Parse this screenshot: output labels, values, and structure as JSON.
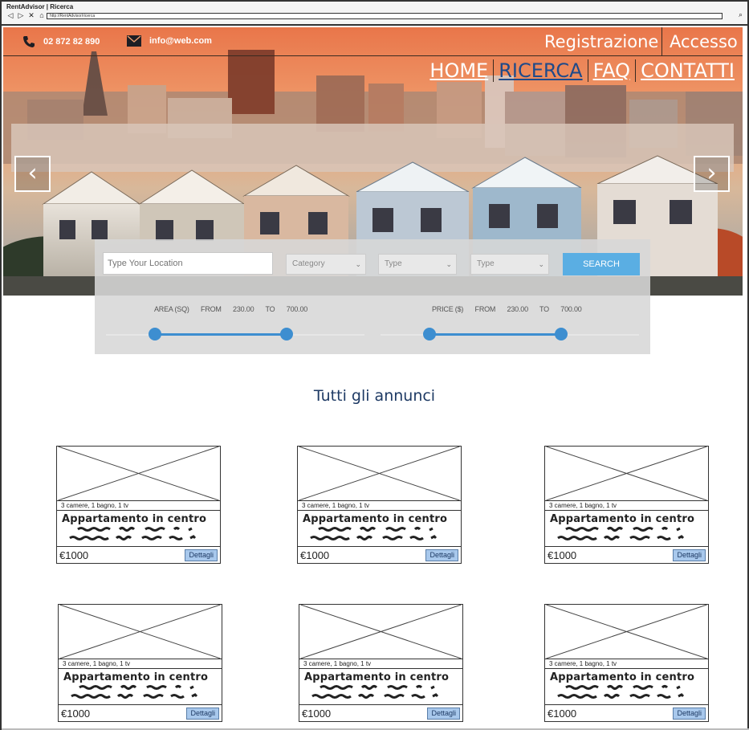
{
  "browser": {
    "title": "RentAdvisor | Ricerca",
    "url": "http://RentAdvisor/ricerca",
    "nav_icons": [
      "back-icon",
      "forward-icon",
      "close-icon",
      "home-icon"
    ]
  },
  "topbar": {
    "phone": "02 872 82 890",
    "email": "info@web.com",
    "register": "Registrazione",
    "login": "Accesso"
  },
  "nav": {
    "items": [
      "HOME",
      "RICERCA",
      "FAQ",
      "CONTATTI"
    ],
    "active": "RICERCA"
  },
  "search": {
    "location_placeholder": "Type Your Location",
    "category": "Category",
    "type1": "Type",
    "type2": "Type",
    "button": "SEARCH",
    "area": {
      "label": "AREA (SQ)",
      "from_label": "FROM",
      "from": "230.00",
      "to_label": "TO",
      "to": "700.00",
      "min_fraction": 0.19,
      "max_fraction": 0.7
    },
    "price": {
      "label": "PRICE ($)",
      "from_label": "FROM",
      "from": "230.00",
      "to_label": "TO",
      "to": "700.00",
      "min_fraction": 0.19,
      "max_fraction": 0.7
    }
  },
  "listings": {
    "title": "Tutti gli annunci",
    "cards": [
      {
        "features": "3 camere, 1 bagno, 1 tv",
        "title": "Appartamento in centro",
        "price": "€1000",
        "details": "Dettagli"
      },
      {
        "features": "3 camere, 1 bagno, 1 tv",
        "title": "Appartamento in centro",
        "price": "€1000",
        "details": "Dettagli"
      },
      {
        "features": "3 camere, 1 bagno, 1 tv",
        "title": "Appartamento in centro",
        "price": "€1000",
        "details": "Dettagli"
      },
      {
        "features": "3 camere, 1 bagno, 1 tv",
        "title": "Appartamento in centro",
        "price": "€1000",
        "details": "Dettagli"
      },
      {
        "features": "3 camere, 1 bagno, 1 tv",
        "title": "Appartamento in centro",
        "price": "€1000",
        "details": "Dettagli"
      },
      {
        "features": "3 camere, 1 bagno, 1 tv",
        "title": "Appartamento in centro",
        "price": "€1000",
        "details": "Dettagli"
      }
    ]
  },
  "colors": {
    "accent": "#5aaee3",
    "slider": "#3d8ed0",
    "nav_active": "#1e4a8a",
    "title": "#1e3a64"
  }
}
